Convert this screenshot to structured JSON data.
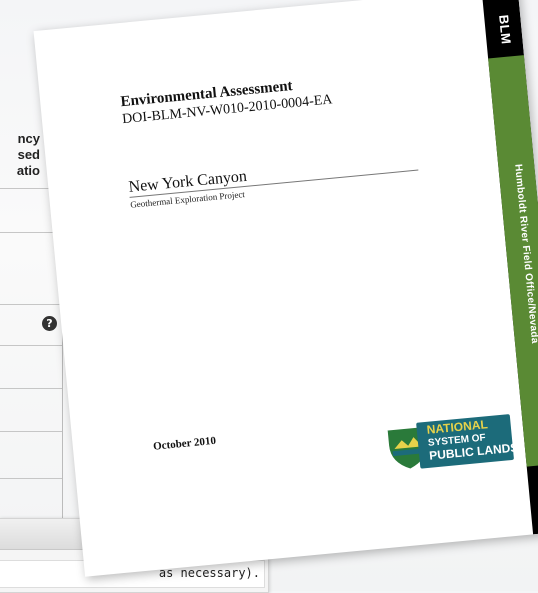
{
  "background": {
    "fragment_lines": [
      "ncy",
      "sed",
      "atio"
    ],
    "badge_glyph": "?"
  },
  "cover": {
    "band_label": "BLM",
    "band_subtitle": "Humboldt River Field Office/Nevada",
    "title": "Environmental Assessment",
    "doc_id": "DOI-BLM-NV-W010-2010-0004-EA",
    "project_name": "New York Canyon",
    "project_subtitle": "Geothermal Exploration Project",
    "date": "October 2010",
    "logo": {
      "line1": "NATIONAL",
      "line2": "SYSTEM OF",
      "line3": "PUBLIC LANDS"
    }
  },
  "dialog": {
    "close_glyph": "✖",
    "body_text": "as necessary)."
  },
  "colors": {
    "band_black": "#000000",
    "band_green": "#5a8a34",
    "logo_teal": "#1c6b7a",
    "logo_gold": "#e7d24a"
  }
}
